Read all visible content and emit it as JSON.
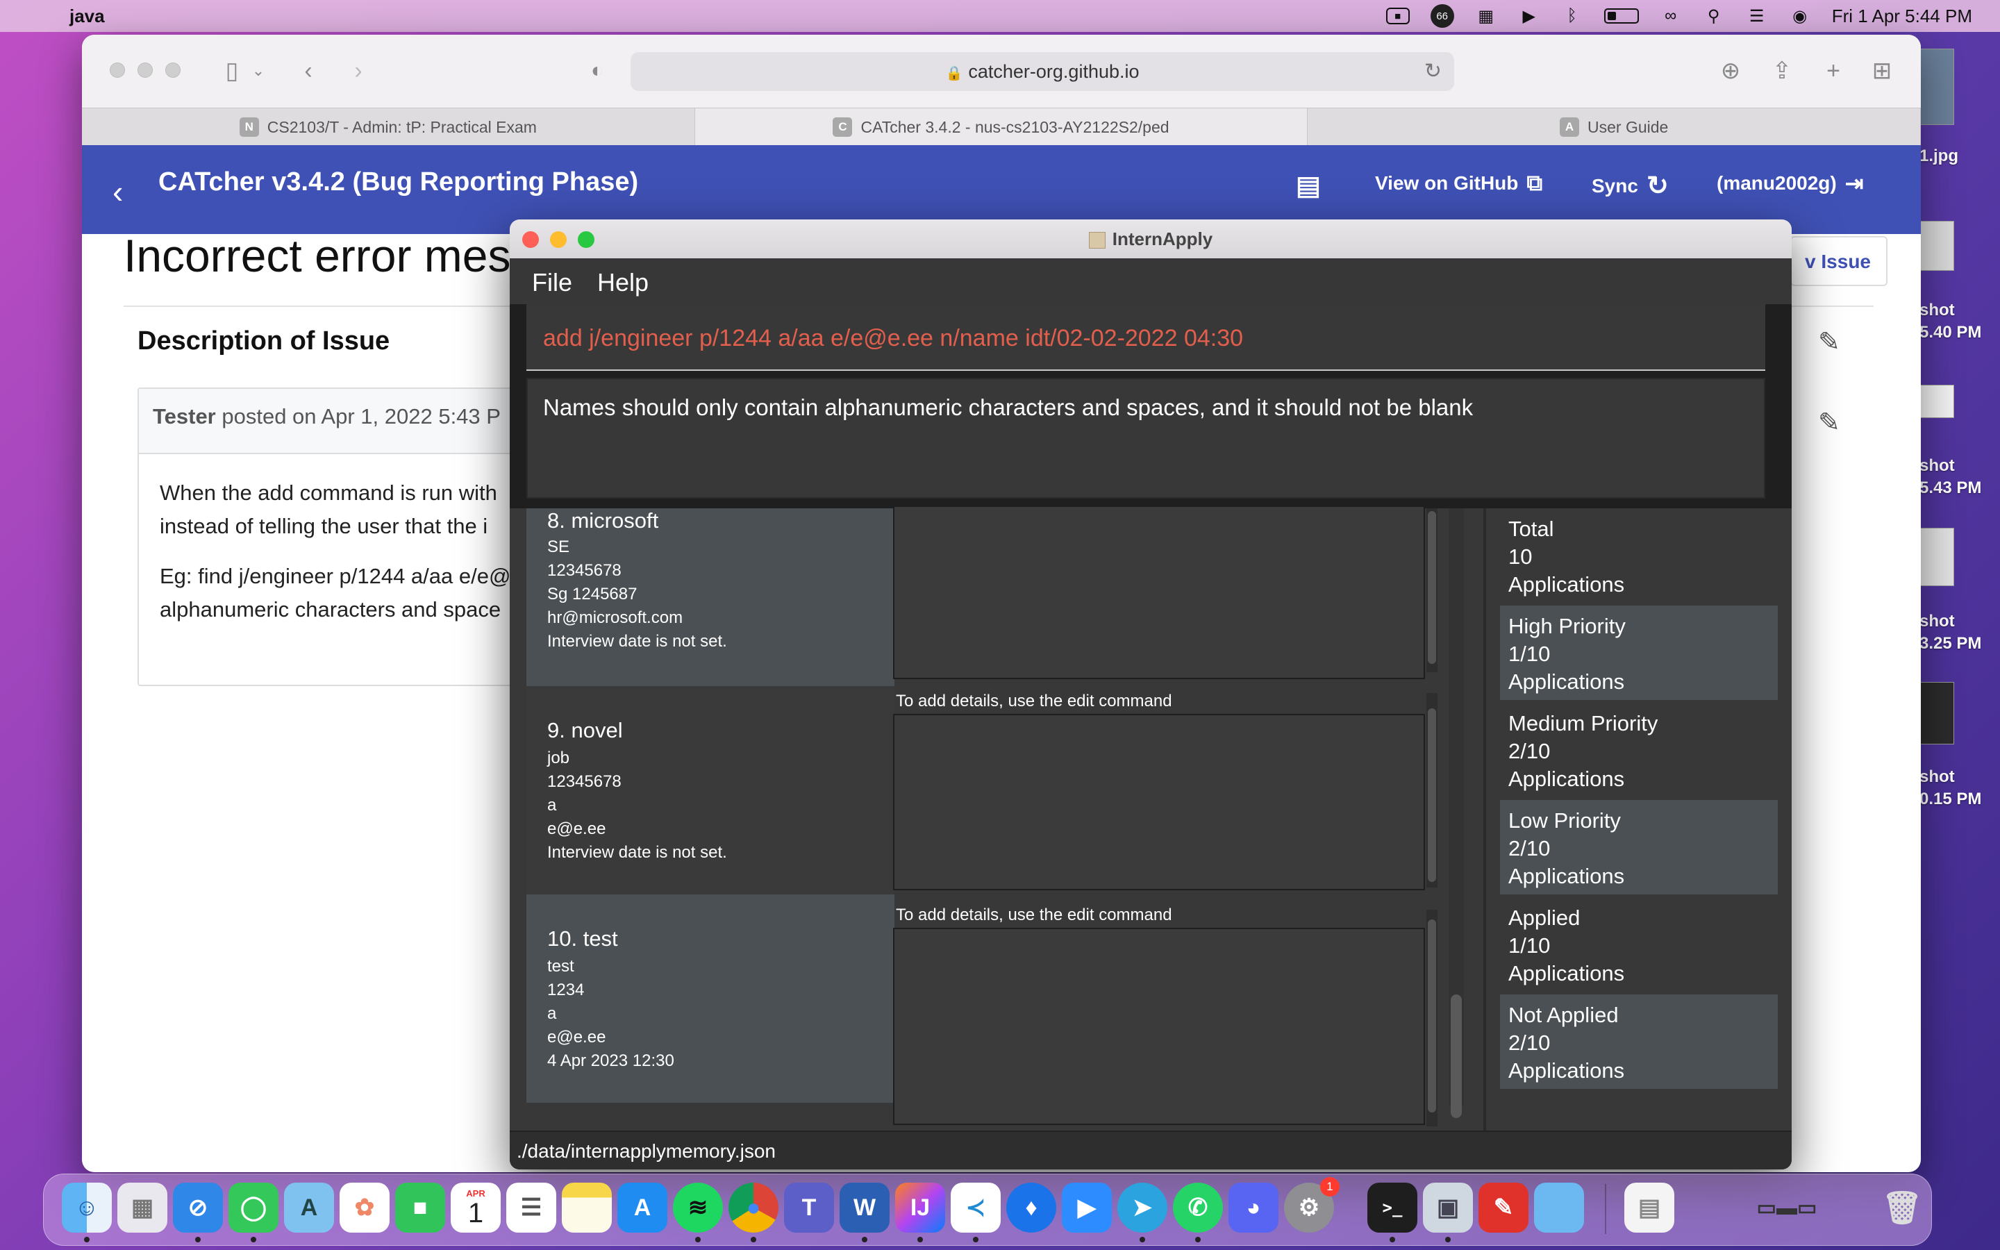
{
  "menubar": {
    "app_name": "java",
    "notification_count": "66",
    "datetime": "Fri 1 Apr  5:44 PM"
  },
  "desktop": {
    "labels": [
      "1.jpg",
      "shot",
      "5.40 PM",
      "shot",
      "5.43 PM",
      "shot",
      "3.25 PM",
      "shot",
      "0.15 PM"
    ]
  },
  "safari": {
    "url": "catcher-org.github.io",
    "tabs": [
      {
        "favicon": "N",
        "label": "CS2103/T - Admin: tP: Practical Exam"
      },
      {
        "favicon": "C",
        "label": "CATcher 3.4.2 - nus-cs2103-AY2122S2/ped"
      },
      {
        "favicon": "A",
        "label": "User Guide"
      }
    ]
  },
  "catcher": {
    "title": "CATcher v3.4.2  (Bug Reporting Phase)",
    "view_on_github": "View on GitHub",
    "sync": "Sync",
    "user": "(manu2002g)",
    "issue_title": "Incorrect error mes",
    "new_issue": "v Issue",
    "description_heading": "Description of Issue",
    "comment": {
      "author": "Tester",
      "posted": " posted on Apr 1, 2022 5:43 P",
      "line1": "When the add command is run with",
      "line2": "instead of telling the user that the i",
      "line3": "Eg: find j/engineer p/1244 a/aa e/e@",
      "line4": "alphanumeric characters and space"
    }
  },
  "internapply": {
    "window_title": "InternApply",
    "menu": {
      "file": "File",
      "help": "Help"
    },
    "command_text": "add j/engineer p/1244 a/aa e/e@e.ee n/name idt/02-02-2022 04:30",
    "result_text": "Names should only contain alphanumeric characters and spaces, and it should not be blank",
    "cards": [
      {
        "index_name": "8.  microsoft",
        "job": "SE",
        "phone": "12345678",
        "address": "Sg 1245687",
        "email": "hr@microsoft.com",
        "interview": "Interview date is not set.",
        "hint": ""
      },
      {
        "index_name": "9.  novel",
        "job": "job",
        "phone": "12345678",
        "address": "a",
        "email": "e@e.ee",
        "interview": "Interview date is not set.",
        "hint": "To add details, use the edit command"
      },
      {
        "index_name": "10.  test",
        "job": "test",
        "phone": "1234",
        "address": "a",
        "email": "e@e.ee",
        "interview": "4 Apr 2023 12:30",
        "hint": "To add details, use the edit command"
      }
    ],
    "stats": [
      {
        "label": "Total",
        "count": "10",
        "unit": "Applications"
      },
      {
        "label": "High Priority",
        "count": "1/10",
        "unit": "Applications"
      },
      {
        "label": "Medium Priority",
        "count": "2/10",
        "unit": "Applications"
      },
      {
        "label": "Low Priority",
        "count": "2/10",
        "unit": "Applications"
      },
      {
        "label": "Applied",
        "count": "1/10",
        "unit": "Applications"
      },
      {
        "label": "Not Applied",
        "count": "2/10",
        "unit": "Applications"
      }
    ],
    "status_path": "./data/internapplymemory.json"
  },
  "dock": {
    "apps": [
      "finder-icon",
      "launchpad-icon",
      "safari-icon",
      "messages-icon",
      "maps-icon",
      "photos-icon",
      "facetime-icon",
      "calendar-icon",
      "reminders-icon",
      "notes-icon",
      "app-store-icon",
      "spotify-icon",
      "chrome-icon",
      "teams-icon",
      "word-icon",
      "intellij-icon",
      "vscode-icon",
      "maps-pin-icon",
      "zoom-icon",
      "telegram-icon",
      "whatsapp-icon",
      "discord-icon",
      "system-preferences-icon",
      "terminal-icon",
      "preview-icon",
      "pdf-icon",
      "folder-icon",
      "document-icon",
      "screenshot-stack-icon",
      "trash-icon"
    ],
    "calendar_month": "APR",
    "calendar_day": "1",
    "badge": "1"
  }
}
